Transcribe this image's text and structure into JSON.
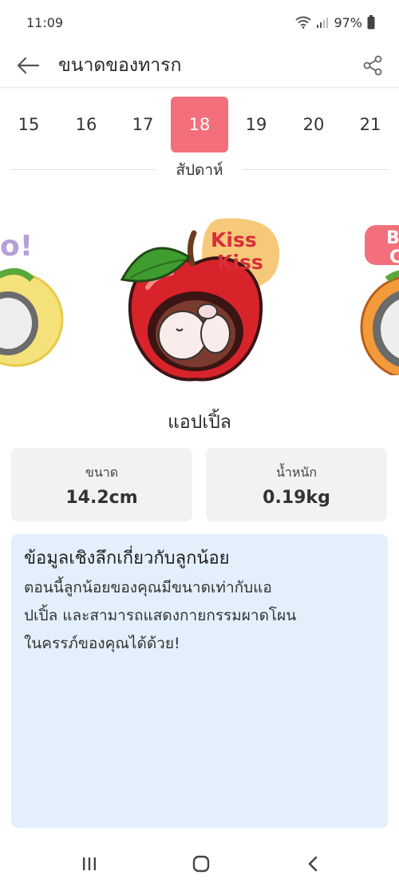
{
  "status_bar": {
    "time": "11:09",
    "battery": "97%"
  },
  "app_bar": {
    "title": "ขนาดของทารก",
    "back_icon": "arrow-left-icon",
    "share_icon": "share-icon"
  },
  "weeks": {
    "items": [
      "15",
      "16",
      "17",
      "18",
      "19",
      "20",
      "21"
    ],
    "selected": "18",
    "label": "สัปดาห์"
  },
  "illustration": {
    "bubble_line1": "Kiss",
    "bubble_line2": "Kiss",
    "left_bubble_text": "o!",
    "right_bubble_text": "B",
    "right_bubble_text2": "C"
  },
  "fruit_name": "แอปเปิ้ล",
  "stats": {
    "size_label": "ขนาด",
    "size_value": "14.2cm",
    "weight_label": "น้ำหนัก",
    "weight_value": "0.19kg"
  },
  "insight": {
    "title": "ข้อมูลเชิงลึกเกี่ยวกับลูกน้อย",
    "line1": "ตอนนี้ลูกน้อยของคุณมีขนาดเท่ากับแอ",
    "line2": "ปเปิ้ล และสามารถแสดงกายกรรมผาดโผน",
    "line3": "ในครรภ์ของคุณได้ด้วย!"
  },
  "nav": {
    "recents_icon": "recents-icon",
    "home_icon": "home-icon",
    "back_icon": "nav-back-icon"
  },
  "colors": {
    "accent": "#f26f7b",
    "insight_bg": "#e3f0fc",
    "card_bg": "#f2f2f2",
    "apple_red": "#d8232a",
    "bubble": "#f6c97a"
  }
}
